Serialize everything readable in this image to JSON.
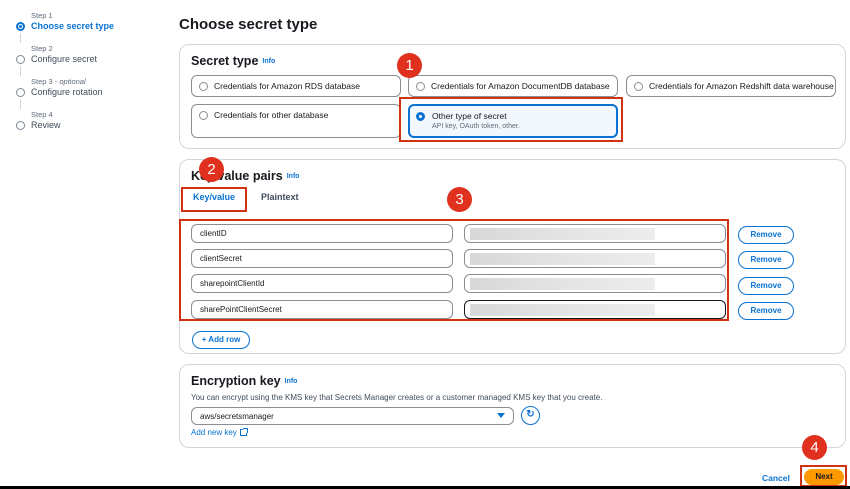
{
  "steps": [
    {
      "num": "Step 1",
      "optional": "",
      "title": "Choose secret type",
      "active": true
    },
    {
      "num": "Step 2",
      "optional": "",
      "title": "Configure secret",
      "active": false
    },
    {
      "num": "Step 3 - ",
      "optional": "optional",
      "title": "Configure rotation",
      "active": false
    },
    {
      "num": "Step 4",
      "optional": "",
      "title": "Review",
      "active": false
    }
  ],
  "page_title": "Choose secret type",
  "secret_type": {
    "title": "Secret type",
    "info": "Info",
    "options": [
      {
        "label": "Credentials for Amazon RDS database"
      },
      {
        "label": "Credentials for Amazon DocumentDB database"
      },
      {
        "label": "Credentials for Amazon Redshift data warehouse"
      },
      {
        "label": "Credentials for other database"
      },
      {
        "label": "Other type of secret",
        "description": "API key, OAuth token, other.",
        "selected": true
      }
    ]
  },
  "kv": {
    "title": "Key/value pairs",
    "info": "Info",
    "tabs": [
      {
        "label": "Key/value",
        "active": true
      },
      {
        "label": "Plaintext",
        "active": false
      }
    ],
    "rows": [
      {
        "key": "clientID"
      },
      {
        "key": "clientSecret"
      },
      {
        "key": "sharepointClientId"
      },
      {
        "key": "sharePointClientSecret"
      }
    ],
    "remove_label": "Remove",
    "add_row_label": "+ Add row"
  },
  "encryption": {
    "title": "Encryption key",
    "info": "Info",
    "description": "You can encrypt using the KMS key that Secrets Manager creates or a customer managed KMS key that you create.",
    "selected": "aws/secretsmanager",
    "add_key_label": "Add new key"
  },
  "footer": {
    "cancel": "Cancel",
    "next": "Next"
  },
  "badges": [
    "1",
    "2",
    "3",
    "4"
  ],
  "colors": {
    "accent": "#0972d3",
    "primary_button": "#ff9900",
    "annotation": "#d13212"
  }
}
